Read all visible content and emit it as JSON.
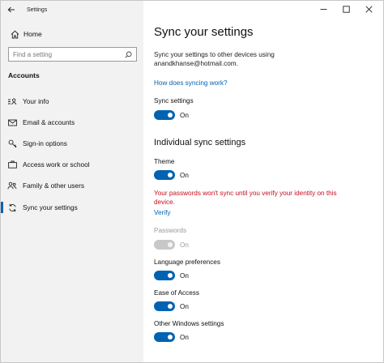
{
  "window": {
    "title": "Settings"
  },
  "sidebar": {
    "home_label": "Home",
    "search": {
      "placeholder": "Find a setting"
    },
    "section": "Accounts",
    "items": [
      {
        "label": "Your info",
        "icon": "person-card-icon"
      },
      {
        "label": "Email & accounts",
        "icon": "mail-icon"
      },
      {
        "label": "Sign-in options",
        "icon": "key-icon"
      },
      {
        "label": "Access work or school",
        "icon": "briefcase-icon"
      },
      {
        "label": "Family & other users",
        "icon": "people-icon"
      },
      {
        "label": "Sync your settings",
        "icon": "sync-icon",
        "active": true
      }
    ]
  },
  "main": {
    "title": "Sync your settings",
    "description_line1": "Sync your settings to other devices using",
    "description_line2": "anandkhanse@hotmail.com.",
    "how_link": "How does syncing work?",
    "sync_settings": {
      "label": "Sync settings",
      "state": "On"
    },
    "individual_heading": "Individual sync settings",
    "theme": {
      "label": "Theme",
      "state": "On"
    },
    "warning": "Your passwords won't sync until you verify your identity on this device.",
    "verify_link": "Verify",
    "passwords": {
      "label": "Passwords",
      "state": "On"
    },
    "language": {
      "label": "Language preferences",
      "state": "On"
    },
    "ease": {
      "label": "Ease of Access",
      "state": "On"
    },
    "other": {
      "label": "Other Windows settings",
      "state": "On"
    }
  },
  "colors": {
    "accent": "#0063b1",
    "warning": "#c50f1f",
    "sidebar_bg": "#f2f2f2"
  }
}
